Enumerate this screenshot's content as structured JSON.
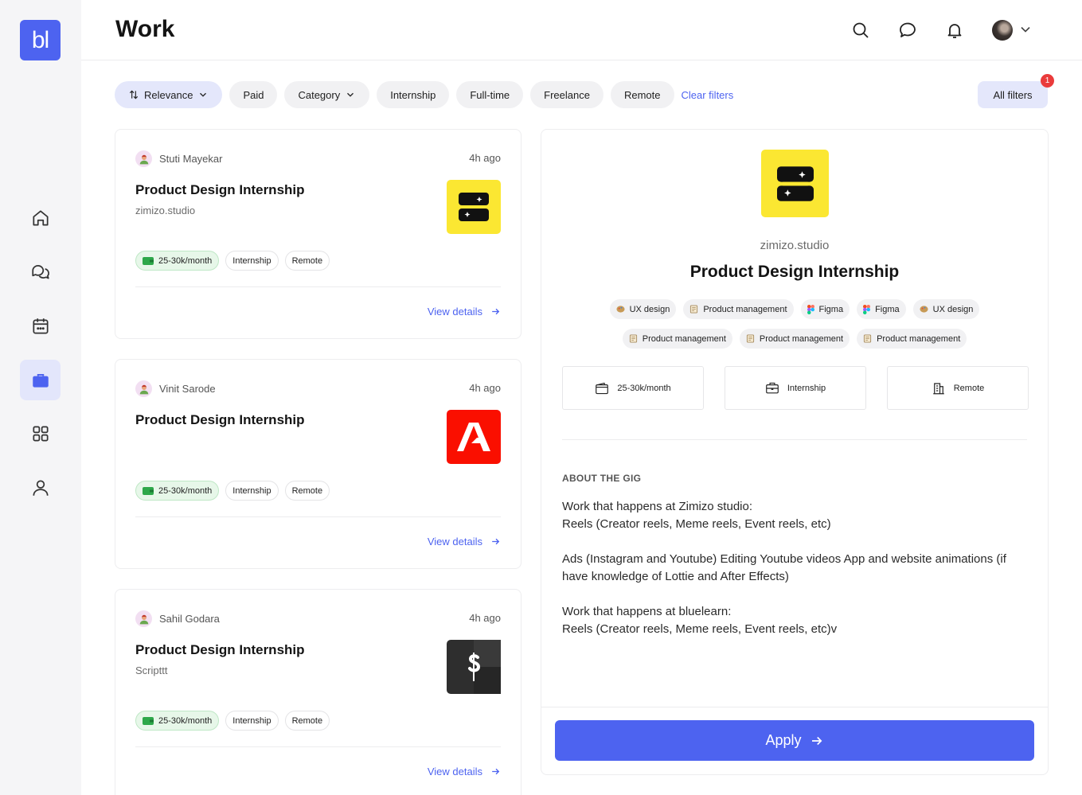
{
  "app": {
    "logo_text": "bl",
    "page_title": "Work"
  },
  "sidebar": {
    "items": [
      {
        "name": "home",
        "active": false
      },
      {
        "name": "messages",
        "active": false
      },
      {
        "name": "calendar",
        "active": false
      },
      {
        "name": "work",
        "active": true
      },
      {
        "name": "apps",
        "active": false
      },
      {
        "name": "profile",
        "active": false
      }
    ]
  },
  "filters": {
    "relevance": "Relevance",
    "paid": "Paid",
    "category": "Category",
    "internship": "Internship",
    "fulltime": "Full-time",
    "freelance": "Freelance",
    "remote": "Remote",
    "clear": "Clear filters",
    "all_filters": "All filters",
    "badge_count": "1"
  },
  "jobs": [
    {
      "author": "Stuti Mayekar",
      "time": "4h ago",
      "title": "Product Design Internship",
      "company": "zimizo.studio",
      "pay": "25-30k/month",
      "type": "Internship",
      "location": "Remote",
      "view": "View details",
      "logo": "zimizo-logo"
    },
    {
      "author": "Vinit Sarode",
      "time": "4h ago",
      "title": "Product Design Internship",
      "company": "",
      "pay": "25-30k/month",
      "type": "Internship",
      "location": "Remote",
      "view": "View details",
      "logo": "adobe-logo"
    },
    {
      "author": "Sahil Godara",
      "time": "4h ago",
      "title": "Product Design Internship",
      "company": "Scripttt",
      "pay": "25-30k/month",
      "type": "Internship",
      "location": "Remote",
      "view": "View details",
      "logo": "scripttt-logo"
    }
  ],
  "detail": {
    "company": "zimizo.studio",
    "title": "Product Design Internship",
    "skills": [
      {
        "label": "UX design",
        "icon": "palette-icon"
      },
      {
        "label": "Product management",
        "icon": "document-icon"
      },
      {
        "label": "Figma",
        "icon": "figma-icon"
      },
      {
        "label": "Figma",
        "icon": "figma-icon"
      },
      {
        "label": "UX design",
        "icon": "palette-icon"
      },
      {
        "label": "Product management",
        "icon": "document-icon"
      },
      {
        "label": "Product management",
        "icon": "document-icon"
      },
      {
        "label": "Product management",
        "icon": "document-icon"
      }
    ],
    "pay": "25-30k/month",
    "type": "Internship",
    "location": "Remote",
    "about_heading": "ABOUT THE GIG",
    "about_p1_l1": "Work that happens at Zimizo studio:",
    "about_p1_l2": "Reels (Creator reels, Meme reels, Event reels, etc)",
    "about_p2": "Ads (Instagram and Youtube) Editing Youtube videos App and website animations (if have knowledge of Lottie and After Effects)",
    "about_p3_l1": "Work that happens at bluelearn:",
    "about_p3_l2": "Reels (Creator reels, Meme reels, Event reels, etc)v",
    "apply": "Apply"
  },
  "colors": {
    "accent": "#4d63f0",
    "badge": "#ea3b3b",
    "zimizo_yellow": "#fbe732",
    "adobe_red": "#fa0f00",
    "scripttt_dark": "#2e2e2e"
  }
}
